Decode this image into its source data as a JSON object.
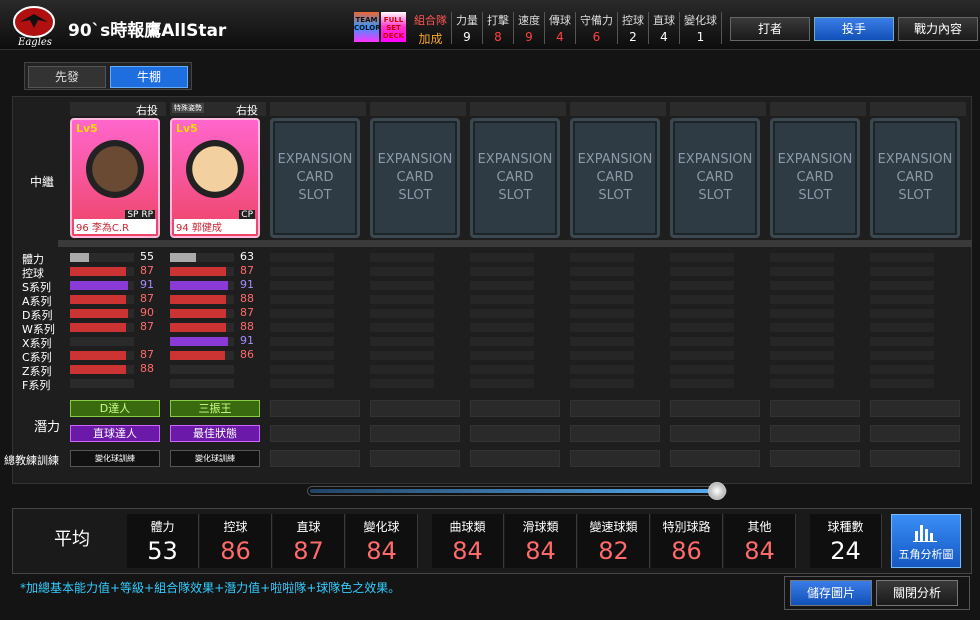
{
  "header": {
    "title": "90`s時報鷹AllStar",
    "logo_text": "Eagles",
    "badge_team": "TEAM COLOR",
    "badge_full": "FULL SET DECK",
    "team_label": "組合隊",
    "team_value": "加成",
    "stats": [
      {
        "label": "力量",
        "value": "9",
        "color": "#ffffff"
      },
      {
        "label": "打擊",
        "value": "8",
        "color": "#ff4040"
      },
      {
        "label": "速度",
        "value": "9",
        "color": "#ff4040"
      },
      {
        "label": "傳球",
        "value": "4",
        "color": "#ff4040"
      },
      {
        "label": "守備力",
        "value": "6",
        "color": "#ff4040"
      },
      {
        "label": "控球",
        "value": "2",
        "color": "#ffffff"
      },
      {
        "label": "直球",
        "value": "4",
        "color": "#ffffff"
      },
      {
        "label": "變化球",
        "value": "1",
        "color": "#ffffff"
      }
    ],
    "tabs": [
      "打者",
      "投手",
      "戰力內容"
    ],
    "active_tab": "投手"
  },
  "subtabs": [
    "先發",
    "牛棚"
  ],
  "active_subtab": "牛棚",
  "row_label": "中繼",
  "potential_label": "潛力",
  "coach_label": "總教練訓練",
  "stat_labels": [
    "體力",
    "控球",
    "S系列",
    "A系列",
    "D系列",
    "W系列",
    "X系列",
    "C系列",
    "Z系列",
    "F系列"
  ],
  "players": [
    {
      "hand": "右投",
      "special": "",
      "card": "96 李為C.R",
      "lv": "Lv5",
      "positions": "SP RP",
      "bars": [
        {
          "v": "55",
          "p": 30,
          "c": "#aaaaaa"
        },
        {
          "v": "87",
          "p": 87,
          "c": "#cc3333"
        },
        {
          "v": "91",
          "p": 91,
          "c": "#8a3ad6"
        },
        {
          "v": "87",
          "p": 87,
          "c": "#cc3333"
        },
        {
          "v": "90",
          "p": 90,
          "c": "#cc3333"
        },
        {
          "v": "87",
          "p": 87,
          "c": "#cc3333"
        },
        {
          "v": "",
          "p": 0,
          "c": ""
        },
        {
          "v": "87",
          "p": 87,
          "c": "#cc3333"
        },
        {
          "v": "88",
          "p": 88,
          "c": "#cc3333"
        },
        {
          "v": "",
          "p": 0,
          "c": ""
        }
      ],
      "pot1": "D達人",
      "pot2": "直球達人",
      "coach": "變化球訓練"
    },
    {
      "hand": "右投",
      "special": "特殊姿勢",
      "card": "94 郭健成",
      "lv": "Lv5",
      "positions": "CP",
      "bars": [
        {
          "v": "63",
          "p": 40,
          "c": "#aaaaaa"
        },
        {
          "v": "87",
          "p": 87,
          "c": "#cc3333"
        },
        {
          "v": "91",
          "p": 91,
          "c": "#8a3ad6"
        },
        {
          "v": "88",
          "p": 88,
          "c": "#cc3333"
        },
        {
          "v": "87",
          "p": 87,
          "c": "#cc3333"
        },
        {
          "v": "88",
          "p": 88,
          "c": "#cc3333"
        },
        {
          "v": "91",
          "p": 91,
          "c": "#8a3ad6"
        },
        {
          "v": "86",
          "p": 86,
          "c": "#cc3333"
        },
        {
          "v": "",
          "p": 0,
          "c": ""
        },
        {
          "v": "",
          "p": 0,
          "c": ""
        }
      ],
      "pot1": "三振王",
      "pot2": "最佳狀態",
      "coach": "變化球訓練"
    }
  ],
  "expansion_text": [
    "EXPANSION",
    "CARD",
    "SLOT"
  ],
  "scroll_value": 1.0,
  "summary": {
    "avg_label": "平均",
    "items": [
      {
        "label": "體力",
        "value": "53",
        "color": "#ffffff"
      },
      {
        "label": "控球",
        "value": "86",
        "color": "#ff6a6a"
      },
      {
        "label": "直球",
        "value": "87",
        "color": "#ff6a6a"
      },
      {
        "label": "變化球",
        "value": "84",
        "color": "#ff6a6a"
      },
      {
        "label": "曲球類",
        "value": "84",
        "color": "#ff6a6a"
      },
      {
        "label": "滑球類",
        "value": "84",
        "color": "#ff6a6a"
      },
      {
        "label": "變速球類",
        "value": "82",
        "color": "#ff6a6a"
      },
      {
        "label": "特別球路",
        "value": "86",
        "color": "#ff6a6a"
      },
      {
        "label": "其他",
        "value": "84",
        "color": "#ff6a6a"
      },
      {
        "label": "球種數",
        "value": "24",
        "color": "#ffffff"
      }
    ],
    "five_label": "五角分析圖"
  },
  "note": "*加總基本能力值+等級+組合隊效果+潛力值+啦啦隊+球隊色之效果。",
  "buttons": {
    "save": "儲存圖片",
    "close": "關閉分析"
  }
}
